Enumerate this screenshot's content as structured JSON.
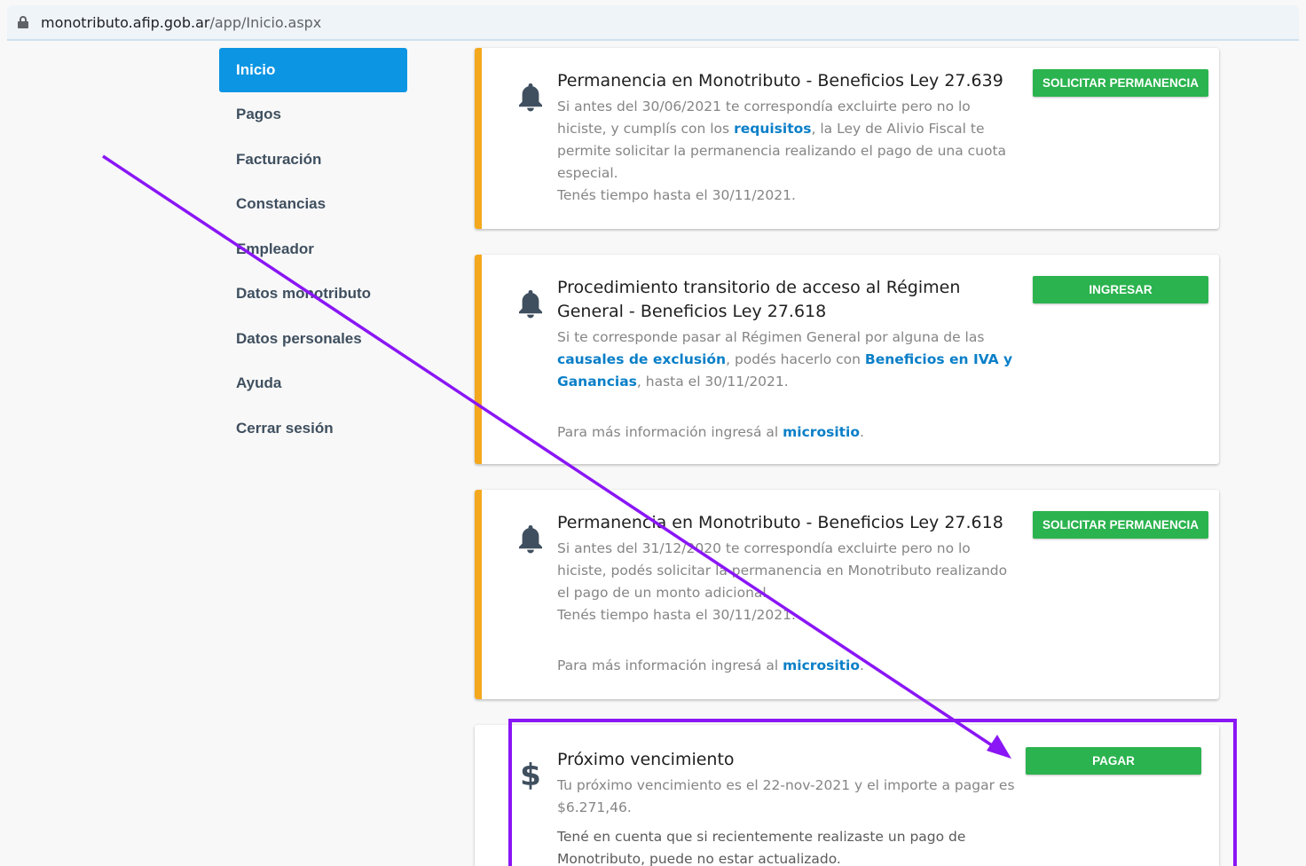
{
  "browser": {
    "url_host": "monotributo.afip.gob.ar",
    "url_path": "/app/Inicio.aspx"
  },
  "sidebar": {
    "items": [
      {
        "label": "Inicio",
        "active": true
      },
      {
        "label": "Pagos"
      },
      {
        "label": "Facturación"
      },
      {
        "label": "Constancias"
      },
      {
        "label": "Empleador"
      },
      {
        "label": "Datos monotributo"
      },
      {
        "label": "Datos personales"
      },
      {
        "label": "Ayuda"
      },
      {
        "label": "Cerrar sesión"
      }
    ]
  },
  "cards": [
    {
      "icon": "bell-icon",
      "title": "Permanencia en Monotributo - Beneficios Ley 27.639",
      "body_1": "Si antes del 30/06/2021 te correspondía excluirte pero no lo hiciste, y cumplís con los ",
      "link_1": "requisitos",
      "body_2": ", la Ley de Alivio Fiscal te permite solicitar la permanencia realizando el pago de una cuota especial.",
      "body_3": "Tenés tiempo hasta el 30/11/2021.",
      "button": "SOLICITAR PERMANENCIA"
    },
    {
      "icon": "bell-icon",
      "title": "Procedimiento transitorio de acceso al Régimen General - Beneficios Ley 27.618",
      "body_1": "Si te corresponde pasar al Régimen General por alguna de las ",
      "link_1": "causales de exclusión",
      "body_2": ", podés hacerlo con ",
      "link_2": "Beneficios en IVA y Ganancias",
      "body_3": ", hasta el 30/11/2021.",
      "info_prefix": "Para más información ingresá al ",
      "info_link": "micrositio",
      "info_suffix": ".",
      "button": "INGRESAR"
    },
    {
      "icon": "bell-icon",
      "title": "Permanencia en Monotributo - Beneficios Ley 27.618",
      "body_1": "Si antes del 31/12/2020 te correspondía excluirte pero no lo hiciste, podés solicitar la permanencia en Monotributo realizando el pago de un monto adicional.",
      "body_2": "Tenés tiempo hasta el 30/11/2021.",
      "info_prefix": "Para más información ingresá al ",
      "info_link": "micrositio",
      "info_suffix": ".",
      "button": "SOLICITAR PERMANENCIA"
    },
    {
      "icon": "dollar-icon",
      "icon_glyph": "$",
      "title": "Próximo vencimiento",
      "body_1": "Tu próximo vencimiento es el 22-nov-2021 y el importe a pagar es $6.271,46.",
      "body_2": "Tené en cuenta que si recientemente realizaste un pago de Monotributo, puede no estar actualizado.",
      "button": "PAGAR"
    }
  ],
  "colors": {
    "accent_blue": "#0c95e3",
    "link_blue": "#0a7fc8",
    "button_green": "#2bb34f",
    "warning_orange": "#f4a81d",
    "annotation_purple": "#8a16f5"
  }
}
